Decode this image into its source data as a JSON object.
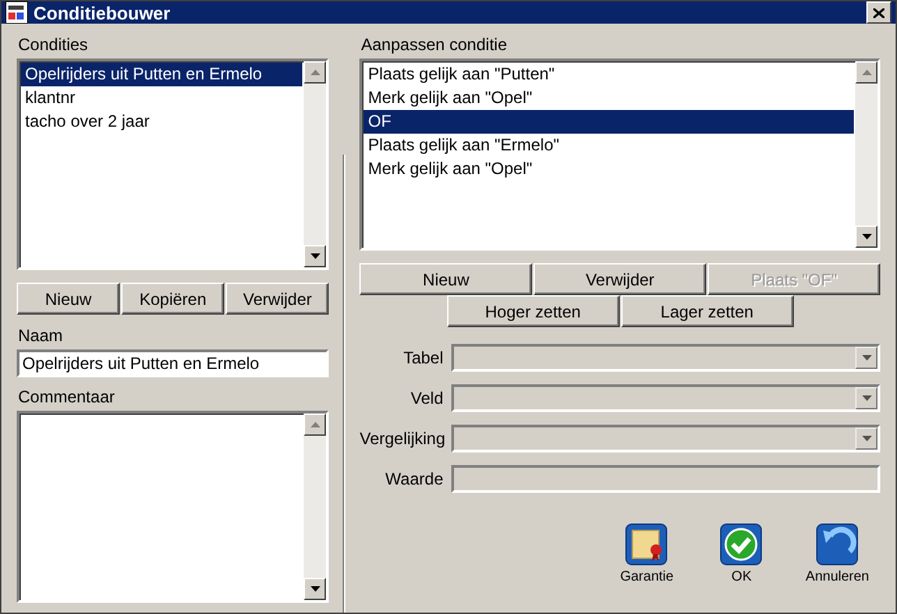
{
  "window": {
    "title": "Conditiebouwer"
  },
  "conditions": {
    "label": "Condities",
    "items": [
      {
        "text": "Opelrijders uit Putten en Ermelo",
        "selected": true
      },
      {
        "text": "klantnr",
        "selected": false
      },
      {
        "text": "tacho over 2 jaar",
        "selected": false
      }
    ],
    "buttons": [
      {
        "label": "Nieuw",
        "disabled": false
      },
      {
        "label": "Kopiëren",
        "disabled": false
      },
      {
        "label": "Verwijder",
        "disabled": false
      }
    ]
  },
  "name": {
    "label": "Naam",
    "value": "Opelrijders uit Putten en Ermelo"
  },
  "comment": {
    "label": "Commentaar"
  },
  "editor": {
    "label": "Aanpassen conditie",
    "items": [
      {
        "text": "Plaats gelijk aan \"Putten\"",
        "selected": false
      },
      {
        "text": "Merk gelijk aan \"Opel\"",
        "selected": false
      },
      {
        "text": "OF",
        "selected": true
      },
      {
        "text": "Plaats gelijk aan \"Ermelo\"",
        "selected": false
      },
      {
        "text": "Merk gelijk aan \"Opel\"",
        "selected": false
      }
    ],
    "buttons": [
      {
        "label": "Nieuw",
        "disabled": false
      },
      {
        "label": "Verwijder",
        "disabled": false
      },
      {
        "label": "Plaats \"OF\"",
        "disabled": true
      }
    ],
    "move_buttons": [
      {
        "label": "Hoger zetten",
        "disabled": false
      },
      {
        "label": "Lager zetten",
        "disabled": false
      }
    ],
    "fields": [
      {
        "label": "Tabel",
        "kind": "dropdown",
        "disabled": true
      },
      {
        "label": "Veld",
        "kind": "dropdown",
        "disabled": true
      },
      {
        "label": "Vergelijking",
        "kind": "dropdown",
        "disabled": true
      },
      {
        "label": "Waarde",
        "kind": "text",
        "disabled": true
      }
    ]
  },
  "actions": [
    {
      "label": "Garantie",
      "kind": "certificate"
    },
    {
      "label": "OK",
      "kind": "ok"
    },
    {
      "label": "Annuleren",
      "kind": "undo"
    }
  ]
}
